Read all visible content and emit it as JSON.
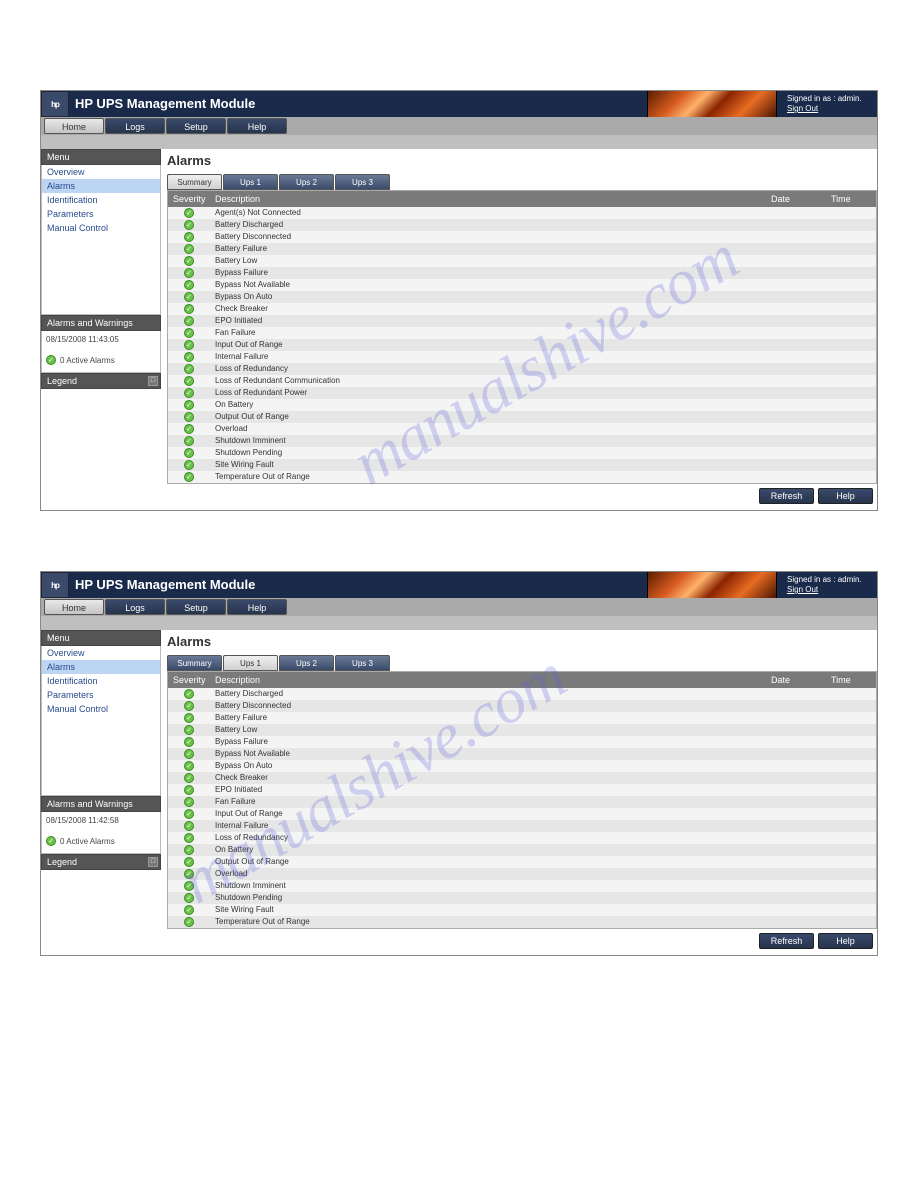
{
  "watermark": "manualshive.com",
  "shots": [
    {
      "app_title": "HP UPS Management Module",
      "signin": {
        "text": "Signed in as : admin.",
        "signout": "Sign Out"
      },
      "nav": [
        {
          "label": "Home",
          "active": true
        },
        {
          "label": "Logs",
          "active": false
        },
        {
          "label": "Setup",
          "active": false
        },
        {
          "label": "Help",
          "active": false
        }
      ],
      "menu_header": "Menu",
      "menu": [
        {
          "label": "Overview",
          "active": false
        },
        {
          "label": "Alarms",
          "active": true
        },
        {
          "label": "Identification",
          "active": false
        },
        {
          "label": "Parameters",
          "active": false
        },
        {
          "label": "Manual Control",
          "active": false
        }
      ],
      "alarms_header": "Alarms and Warnings",
      "alarms_ts": "08/15/2008 11:43:05",
      "alarms_active": "0 Active Alarms",
      "legend_header": "Legend",
      "page_title": "Alarms",
      "subtabs": [
        {
          "label": "Summary",
          "active": true
        },
        {
          "label": "Ups 1",
          "active": false
        },
        {
          "label": "Ups 2",
          "active": false
        },
        {
          "label": "Ups 3",
          "active": false
        }
      ],
      "columns": {
        "severity": "Severity",
        "description": "Description",
        "date": "Date",
        "time": "Time"
      },
      "rows": [
        "Agent(s) Not Connected",
        "Battery Discharged",
        "Battery Disconnected",
        "Battery Failure",
        "Battery Low",
        "Bypass Failure",
        "Bypass Not Available",
        "Bypass On Auto",
        "Check Breaker",
        "EPO Initiated",
        "Fan Failure",
        "Input Out of Range",
        "Internal Failure",
        "Loss of Redundancy",
        "Loss of Redundant Communication",
        "Loss of Redundant Power",
        "On Battery",
        "Output Out of Range",
        "Overload",
        "Shutdown Imminent",
        "Shutdown Pending",
        "Site Wiring Fault",
        "Temperature Out of Range"
      ],
      "buttons": {
        "refresh": "Refresh",
        "help": "Help"
      }
    },
    {
      "app_title": "HP UPS Management Module",
      "signin": {
        "text": "Signed in as : admin.",
        "signout": "Sign Out"
      },
      "nav": [
        {
          "label": "Home",
          "active": true
        },
        {
          "label": "Logs",
          "active": false
        },
        {
          "label": "Setup",
          "active": false
        },
        {
          "label": "Help",
          "active": false
        }
      ],
      "menu_header": "Menu",
      "menu": [
        {
          "label": "Overview",
          "active": false
        },
        {
          "label": "Alarms",
          "active": true
        },
        {
          "label": "Identification",
          "active": false
        },
        {
          "label": "Parameters",
          "active": false
        },
        {
          "label": "Manual Control",
          "active": false
        }
      ],
      "alarms_header": "Alarms and Warnings",
      "alarms_ts": "08/15/2008 11:42:58",
      "alarms_active": "0 Active Alarms",
      "legend_header": "Legend",
      "page_title": "Alarms",
      "subtabs": [
        {
          "label": "Summary",
          "active": false
        },
        {
          "label": "Ups 1",
          "active": true
        },
        {
          "label": "Ups 2",
          "active": false
        },
        {
          "label": "Ups 3",
          "active": false
        }
      ],
      "columns": {
        "severity": "Severity",
        "description": "Description",
        "date": "Date",
        "time": "Time"
      },
      "rows": [
        "Battery Discharged",
        "Battery Disconnected",
        "Battery Failure",
        "Battery Low",
        "Bypass Failure",
        "Bypass Not Available",
        "Bypass On Auto",
        "Check Breaker",
        "EPO Initiated",
        "Fan Failure",
        "Input Out of Range",
        "Internal Failure",
        "Loss of Redundancy",
        "On Battery",
        "Output Out of Range",
        "Overload",
        "Shutdown Imminent",
        "Shutdown Pending",
        "Site Wiring Fault",
        "Temperature Out of Range"
      ],
      "buttons": {
        "refresh": "Refresh",
        "help": "Help"
      }
    }
  ]
}
